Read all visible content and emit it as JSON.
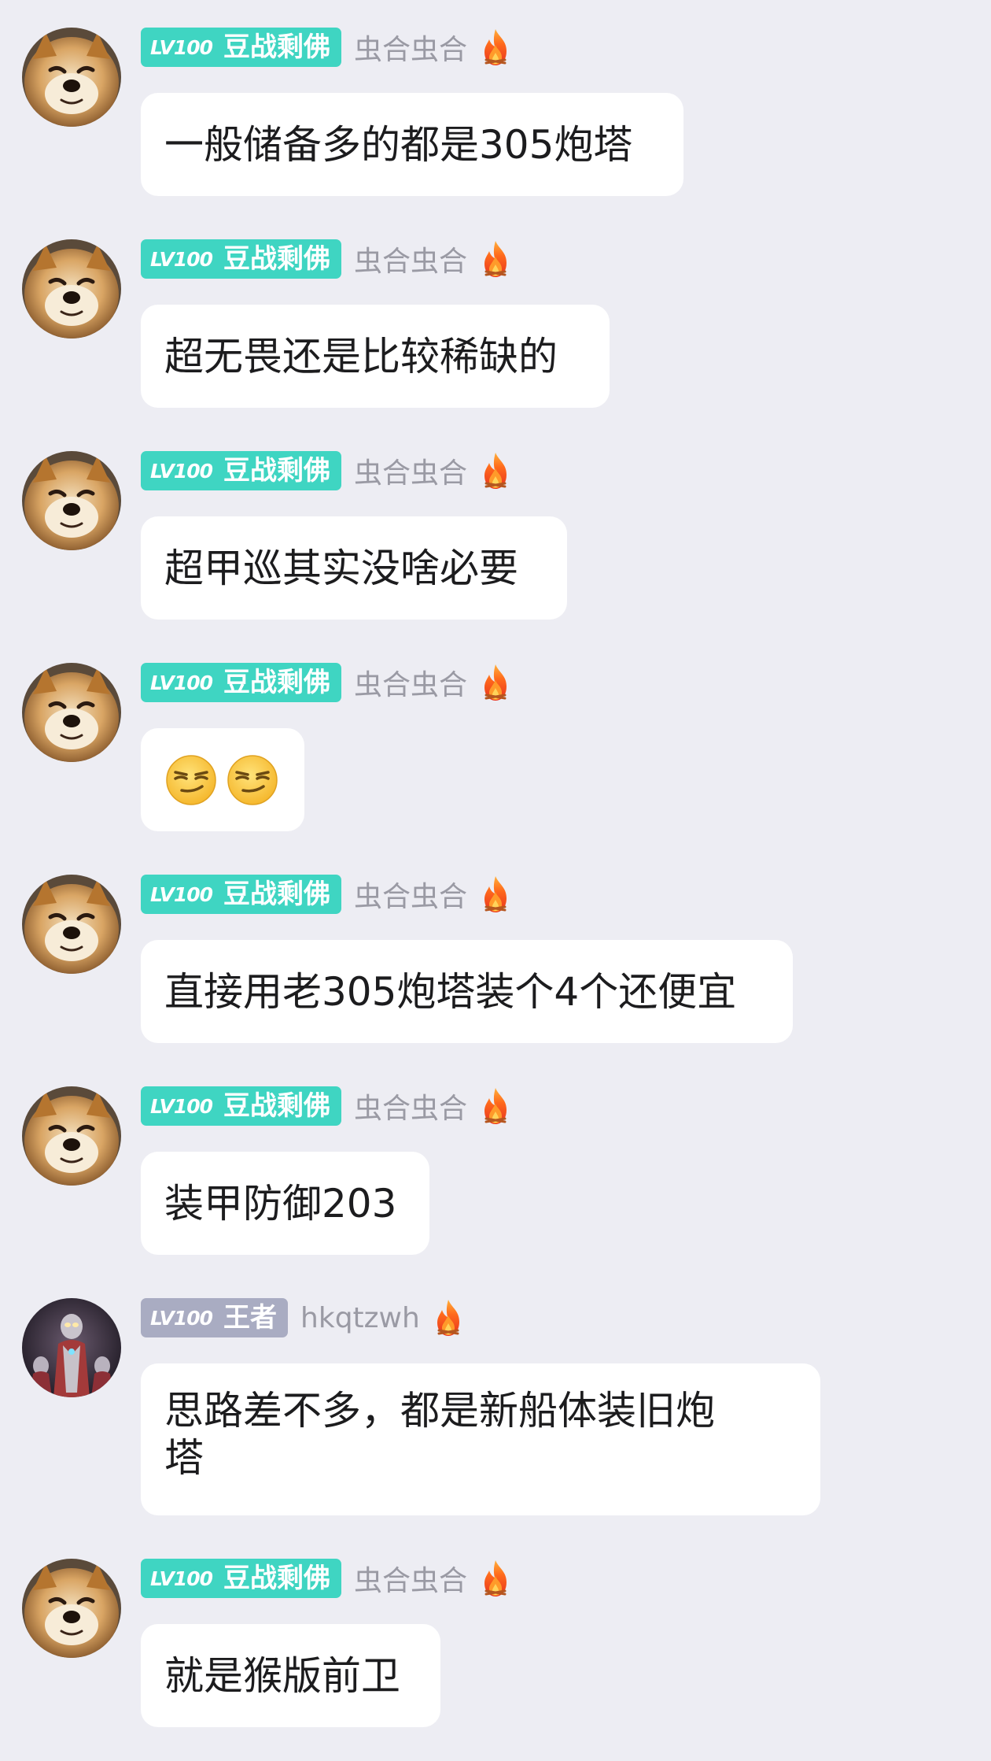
{
  "messages": [
    {
      "avatar": "shiba-dog-avatar",
      "level": "LV100",
      "title": "豆战剩佛",
      "username": "虫合虫合",
      "text": "一般储备多的都是305炮塔"
    },
    {
      "avatar": "shiba-dog-avatar",
      "level": "LV100",
      "title": "豆战剩佛",
      "username": "虫合虫合",
      "text": "超无畏还是比较稀缺的"
    },
    {
      "avatar": "shiba-dog-avatar",
      "level": "LV100",
      "title": "豆战剩佛",
      "username": "虫合虫合",
      "text": "超甲巡其实没啥必要"
    },
    {
      "avatar": "shiba-dog-avatar",
      "level": "LV100",
      "title": "豆战剩佛",
      "username": "虫合虫合",
      "emojis": [
        "smirk-face-emoji",
        "smirk-face-emoji"
      ]
    },
    {
      "avatar": "shiba-dog-avatar",
      "level": "LV100",
      "title": "豆战剩佛",
      "username": "虫合虫合",
      "text": "直接用老305炮塔装个4个还便宜"
    },
    {
      "avatar": "shiba-dog-avatar",
      "level": "LV100",
      "title": "豆战剩佛",
      "username": "虫合虫合",
      "text": "装甲防御203"
    },
    {
      "avatar": "ultraman-figure-avatar",
      "level": "LV100",
      "title": "王者",
      "username": "hkqtzwh",
      "text": "思路差不多，都是新船体装旧炮\n塔"
    },
    {
      "avatar": "shiba-dog-avatar",
      "level": "LV100",
      "title": "豆战剩佛",
      "username": "虫合虫合",
      "text": "就是猴版前卫"
    }
  ],
  "colors": {
    "background": "#ededf3",
    "badge_teal": "#3fd5c2",
    "badge_gray": "#a9acc2",
    "bubble": "#ffffff",
    "username": "#9a9aa4"
  },
  "icons": {
    "fire": "fire-icon"
  }
}
